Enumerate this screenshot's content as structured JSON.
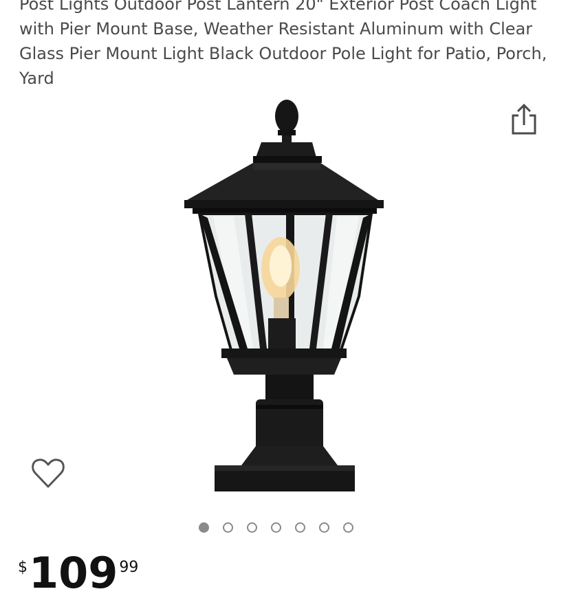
{
  "product": {
    "title": "Post Lights Outdoor Post Lantern 20\" Exterior Post Coach Light with Pier Mount Base, Weather Resistant Aluminum with Clear Glass Pier Mount Light Black Outdoor Pole Light for Patio, Porch, Yard"
  },
  "image": {
    "subject": "black-outdoor-post-lantern",
    "gallery_count": 7,
    "active_index": 0
  },
  "icons": {
    "share": "share-icon",
    "wishlist": "heart-icon"
  },
  "price": {
    "symbol": "$",
    "whole": "109",
    "fraction": "99"
  },
  "colors": {
    "title_text": "#4a4a4a",
    "dot": "#8a8a8a",
    "price_text": "#111111"
  }
}
